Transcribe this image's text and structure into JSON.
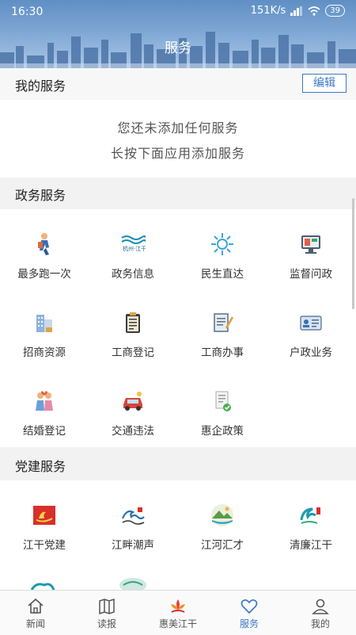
{
  "status": {
    "time": "16:30",
    "speed": "151K/s",
    "battery": "39"
  },
  "page": {
    "title": "服务"
  },
  "my_services": {
    "title": "我的服务",
    "edit_label": "编辑",
    "empty_line1": "您还未添加任何服务",
    "empty_line2": "长按下面应用添加服务"
  },
  "gov_services": {
    "title": "政务服务",
    "items": [
      {
        "label": "最多跑一次",
        "icon": "runner-icon"
      },
      {
        "label": "政务信息",
        "icon": "hangzhou-jianggan-logo-icon",
        "logo_text": "杭州·江干"
      },
      {
        "label": "民生直达",
        "icon": "sun-burst-icon"
      },
      {
        "label": "监督问政",
        "icon": "monitor-icon"
      },
      {
        "label": "招商资源",
        "icon": "buildings-icon"
      },
      {
        "label": "工商登记",
        "icon": "clipboard-icon"
      },
      {
        "label": "工商办事",
        "icon": "document-pen-icon"
      },
      {
        "label": "户政业务",
        "icon": "id-card-icon"
      },
      {
        "label": "结婚登记",
        "icon": "couple-icon"
      },
      {
        "label": "交通违法",
        "icon": "car-icon"
      },
      {
        "label": "惠企政策",
        "icon": "policy-doc-icon"
      }
    ]
  },
  "party_services": {
    "title": "党建服务",
    "items": [
      {
        "label": "江干党建",
        "icon": "party-flag-icon"
      },
      {
        "label": "江畔潮声",
        "icon": "tide-wave-icon"
      },
      {
        "label": "江河汇才",
        "icon": "landscape-icon"
      },
      {
        "label": "清廉江干",
        "icon": "wave-seal-icon"
      }
    ]
  },
  "tabs": [
    {
      "label": "新闻",
      "icon": "home-icon"
    },
    {
      "label": "读报",
      "icon": "map-book-icon"
    },
    {
      "label": "惠美江干",
      "icon": "lotus-logo-icon"
    },
    {
      "label": "服务",
      "icon": "heart-icon",
      "active": true
    },
    {
      "label": "我的",
      "icon": "person-icon"
    }
  ],
  "colors": {
    "accent": "#3d78c6",
    "header_top": "#5f8fc4"
  }
}
